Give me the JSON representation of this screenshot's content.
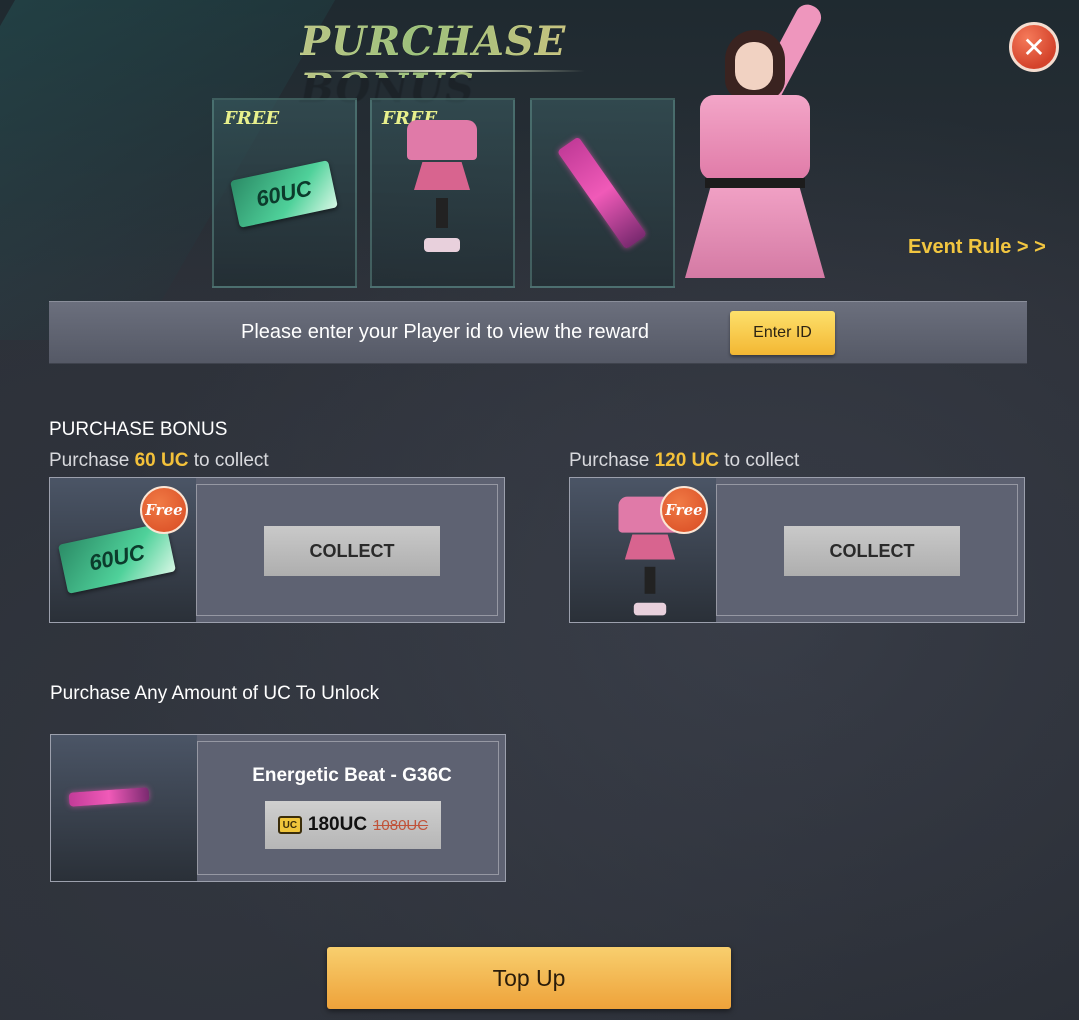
{
  "banner": {
    "title": "PURCHASE BONUS",
    "showcase": [
      {
        "tag": "FREE",
        "item": "60 UC"
      },
      {
        "tag": "FREE",
        "item": "outfit"
      },
      {
        "tag": "",
        "item": "weapon"
      }
    ],
    "uc_card_text": "60UC",
    "event_rule": "Event Rule > >",
    "close_icon": "close-icon"
  },
  "id_bar": {
    "prompt": "Please enter your Player id to view the reward",
    "button": "Enter ID"
  },
  "purchase_bonus": {
    "heading": "PURCHASE BONUS",
    "rewards": [
      {
        "prefix": "Purchase",
        "amount": "60 UC",
        "suffix": "to collect",
        "badge": "Free",
        "button": "COLLECT",
        "thumb_text": "60UC"
      },
      {
        "prefix": "Purchase",
        "amount": "120 UC",
        "suffix": "to collect",
        "badge": "Free",
        "button": "COLLECT"
      }
    ]
  },
  "unlock": {
    "heading": "Purchase Any Amount of UC To Unlock",
    "item_name": "Energetic Beat - G36C",
    "currency_icon": "UC",
    "price_now": "180UC",
    "price_old": "1080UC"
  },
  "footer": {
    "topup": "Top Up"
  },
  "colors": {
    "accent_gold": "#f3c13a",
    "close_red": "#d4432b",
    "topup_orange": "#eea23a"
  }
}
